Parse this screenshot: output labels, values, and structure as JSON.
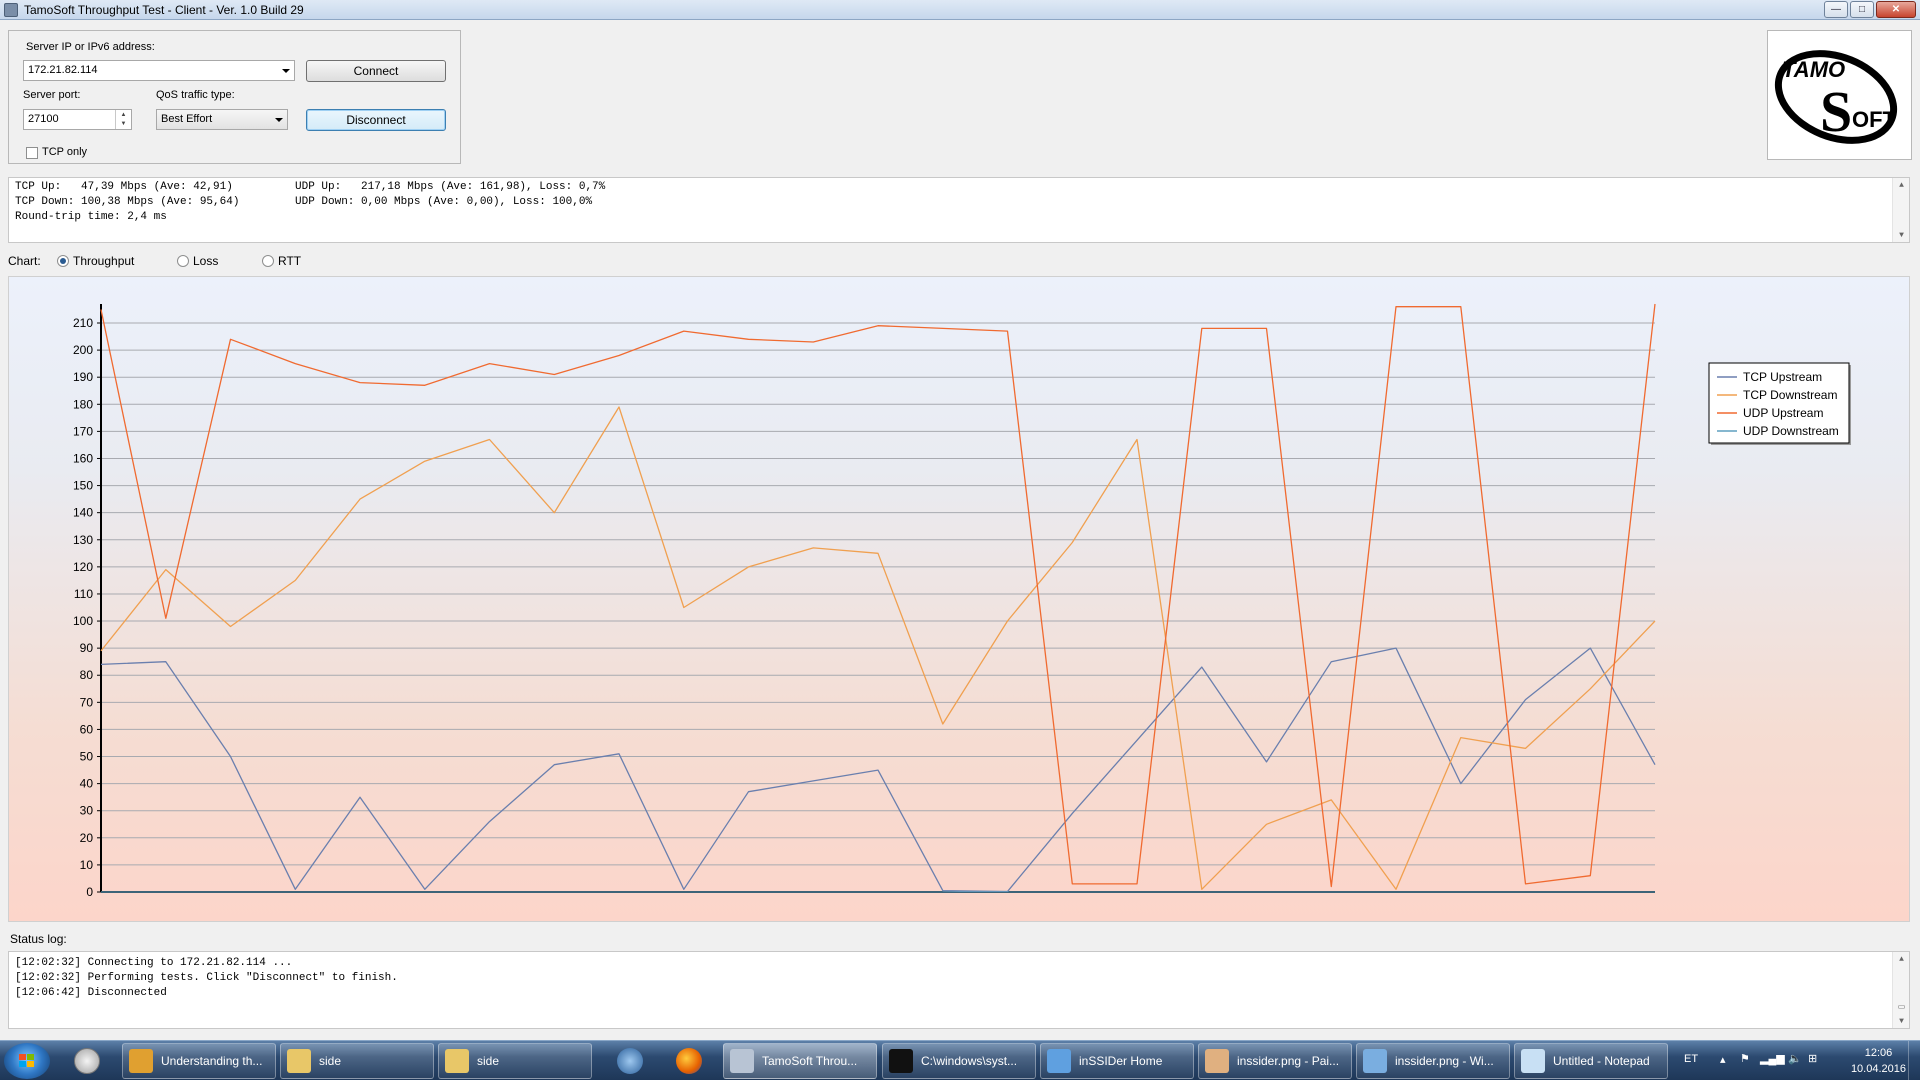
{
  "window": {
    "title": "TamoSoft Throughput Test - Client - Ver. 1.0 Build 29",
    "min_glyph": "—",
    "max_glyph": "□",
    "close_glyph": "✕"
  },
  "connection": {
    "server_label": "Server IP or IPv6  address:",
    "server_value": "172.21.82.114",
    "port_label": "Server port:",
    "port_value": "27100",
    "qos_label": "QoS traffic type:",
    "qos_value": "Best Effort",
    "tcp_only_label": "TCP only",
    "tcp_only_checked": false,
    "connect_label": "Connect",
    "disconnect_label": "Disconnect"
  },
  "logo": {
    "text_top": "TAMO",
    "text_bottom": "OFT",
    "s": "S"
  },
  "stats": {
    "tcp_up": "TCP Up:   47,39 Mbps (Ave: 42,91)",
    "tcp_down": "TCP Down: 100,38 Mbps (Ave: 95,64)",
    "rtt": "Round-trip time: 2,4 ms",
    "udp_up": "UDP Up:   217,18 Mbps (Ave: 161,98), Loss: 0,7%",
    "udp_down": "UDP Down: 0,00 Mbps (Ave: 0,00), Loss: 100,0%"
  },
  "chart_selector": {
    "label": "Chart:",
    "options": [
      "Throughput",
      "Loss",
      "RTT"
    ],
    "selected": "Throughput"
  },
  "chart_data": {
    "type": "line",
    "ylim": [
      0,
      210
    ],
    "yticks": [
      0,
      10,
      20,
      30,
      40,
      50,
      60,
      70,
      80,
      90,
      100,
      110,
      120,
      130,
      140,
      150,
      160,
      170,
      180,
      190,
      200,
      210
    ],
    "grid": true,
    "legend_position": "right",
    "series": [
      {
        "name": "TCP Upstream",
        "color": "#6a7fae",
        "values": [
          84,
          85,
          50,
          1,
          35,
          1,
          26,
          47,
          51,
          1,
          37,
          41,
          45,
          0.5,
          0.2,
          29,
          56,
          83,
          48,
          85,
          90,
          40,
          71,
          90,
          47
        ]
      },
      {
        "name": "TCP Downstream",
        "color": "#f0a050",
        "values": [
          89,
          119,
          98,
          115,
          145,
          159,
          167,
          140,
          179,
          105,
          120,
          127,
          125,
          62,
          100,
          129,
          167,
          1,
          25,
          34,
          1,
          57,
          53,
          75,
          100
        ]
      },
      {
        "name": "UDP Upstream",
        "color": "#f06a30",
        "values": [
          215,
          101,
          204,
          195,
          188,
          187,
          195,
          191,
          198,
          207,
          204,
          203,
          209,
          208,
          207,
          3,
          3,
          208,
          208,
          2,
          216,
          216,
          3,
          6,
          217
        ]
      },
      {
        "name": "UDP Downstream",
        "color": "#5f9fbf",
        "values": [
          0,
          0,
          0,
          0,
          0,
          0,
          0,
          0,
          0,
          0,
          0,
          0,
          0,
          0,
          0,
          0,
          0,
          0,
          0,
          0,
          0,
          0,
          0,
          0,
          0
        ]
      }
    ]
  },
  "status": {
    "label": "Status log:",
    "lines": [
      "[12:02:32] Connecting to 172.21.82.114 ...",
      "[12:02:32] Performing tests. Click \"Disconnect\" to finish.",
      "[12:06:42] Disconnected"
    ]
  },
  "taskbar": {
    "items": [
      {
        "label": "Understanding th...",
        "icon_color": "#e0a030"
      },
      {
        "label": "side",
        "icon_color": "#e8c768"
      },
      {
        "label": "side",
        "icon_color": "#e8c768"
      },
      {
        "label": "TamoSoft Throu...",
        "icon_color": "#b8c4d4"
      },
      {
        "label": "C:\\windows\\syst...",
        "icon_color": "#111111"
      },
      {
        "label": "inSSIDer Home",
        "icon_color": "#5fa0e0"
      },
      {
        "label": "inssider.png - Pai...",
        "icon_color": "#e0b080"
      },
      {
        "label": "inssider.png - Wi...",
        "icon_color": "#7aaee0"
      },
      {
        "label": "Untitled - Notepad",
        "icon_color": "#c8e0f4"
      }
    ],
    "lang": "ET",
    "time": "12:06",
    "date": "10.04.2016"
  }
}
